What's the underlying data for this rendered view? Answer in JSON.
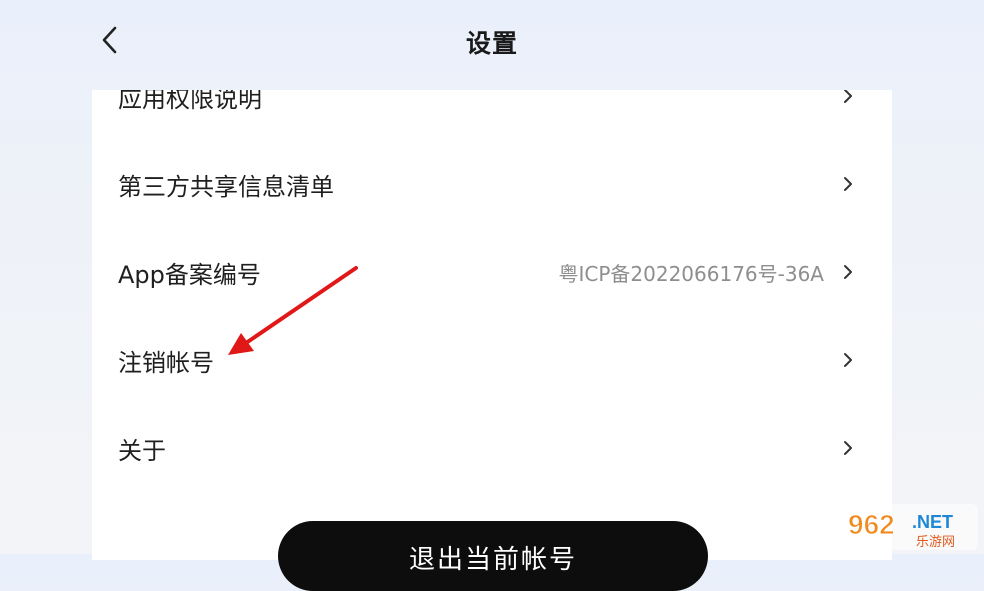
{
  "header": {
    "title": "设置",
    "back_icon": "chevron-left-icon"
  },
  "settings": {
    "items": [
      {
        "label": "应用权限说明",
        "value": ""
      },
      {
        "label": "第三方共享信息清单",
        "value": ""
      },
      {
        "label": "App备案编号",
        "value": "粤ICP备2022066176号-36A"
      },
      {
        "label": "注销帐号",
        "value": ""
      },
      {
        "label": "关于",
        "value": ""
      }
    ]
  },
  "logout": {
    "label": "退出当前帐号"
  },
  "annotation": {
    "color": "#e01818",
    "icon": "red-arrow-icon"
  },
  "watermark": {
    "brand": "962",
    "domain": ".NET",
    "subtitle": "乐游网"
  },
  "colors": {
    "button": "#0d0d0d",
    "value_text": "#8e8e8e",
    "card": "#ffffff"
  }
}
